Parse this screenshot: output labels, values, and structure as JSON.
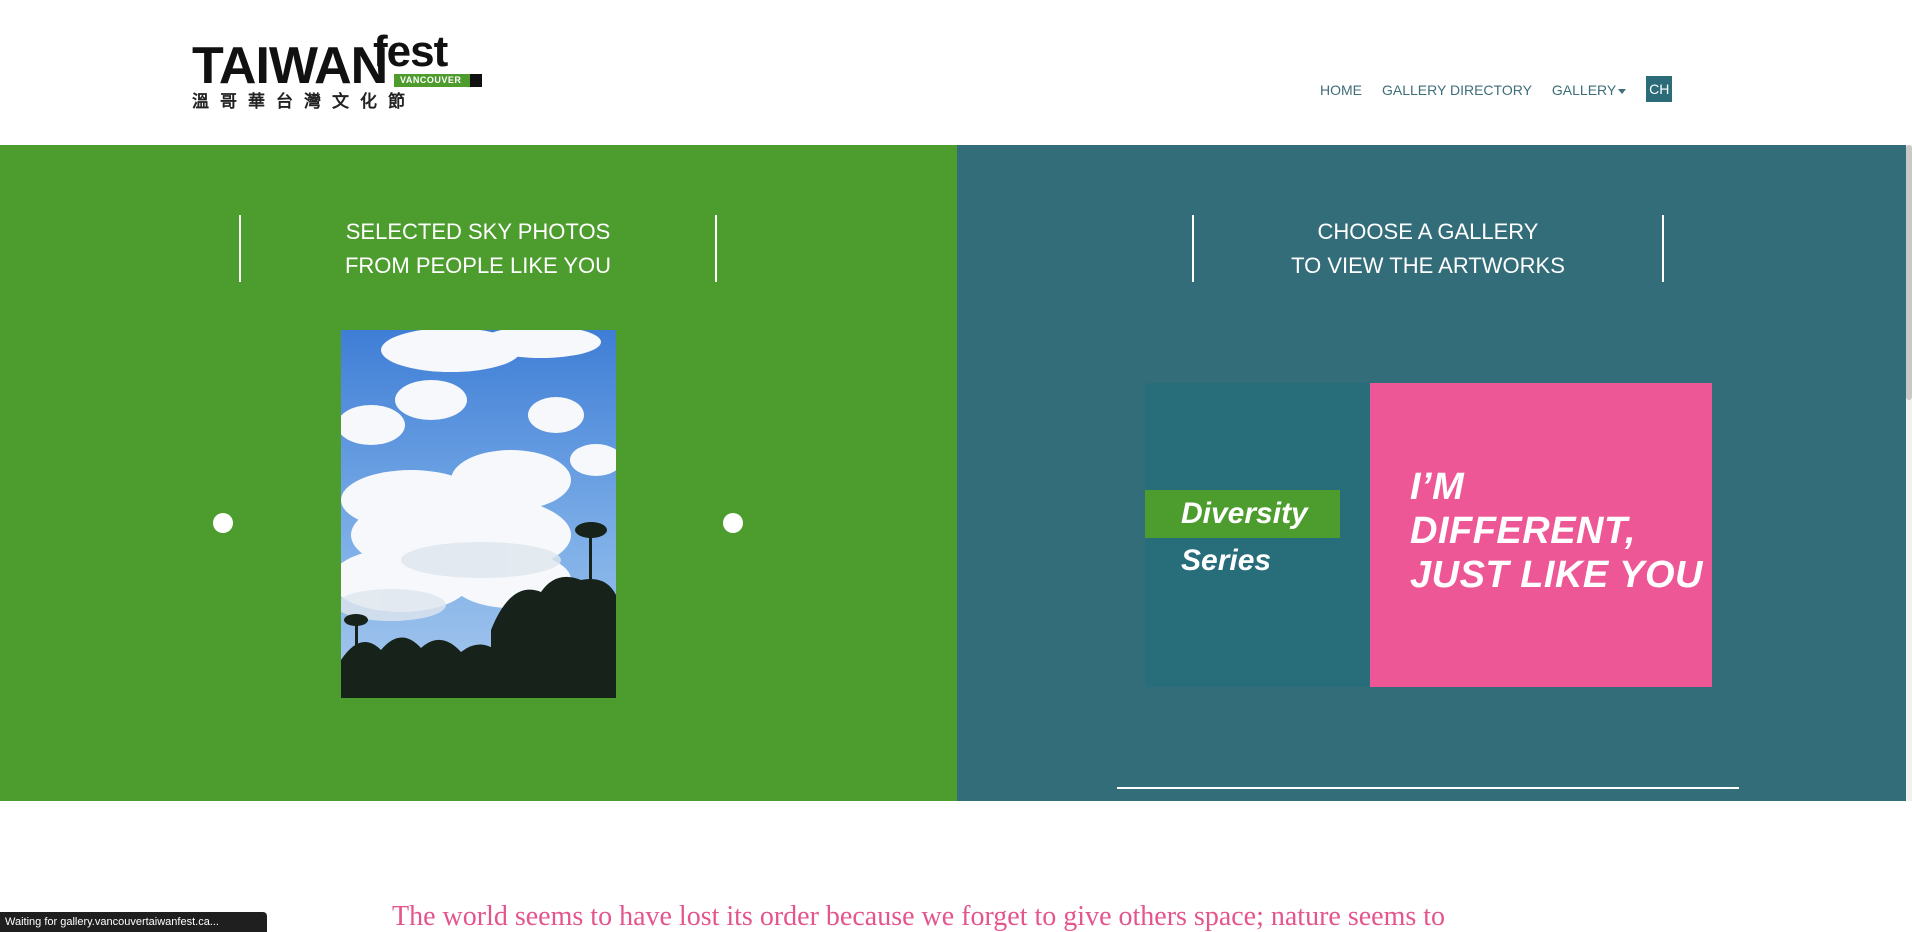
{
  "logo": {
    "main": "TAIWAN",
    "fest": "fest",
    "tag": "VANCOUVER",
    "chinese": "溫哥華台灣文化節"
  },
  "nav": {
    "home": "HOME",
    "directory": "GALLERY DIRECTORY",
    "gallery": "GALLERY",
    "language": "CH"
  },
  "left_panel": {
    "heading_line1": "SELECTED SKY PHOTOS",
    "heading_line2": "FROM PEOPLE LIKE YOU"
  },
  "right_panel": {
    "heading_line1": "CHOOSE A GALLERY",
    "heading_line2": "TO VIEW THE ARTWORKS",
    "card": {
      "diversity": "Diversity",
      "series": "Series",
      "line1": "I’M",
      "line2": "DIFFERENT,",
      "line3": "JUST LIKE YOU"
    }
  },
  "quote": "The world seems to have lost its order because we forget to give others space; nature seems to",
  "status_bar": "Waiting for gallery.vancouvertaiwanfest.ca...",
  "colors": {
    "green": "#4c9c2e",
    "teal": "#336d79",
    "pink": "#ee5796",
    "nav_text": "#3e6e78"
  }
}
